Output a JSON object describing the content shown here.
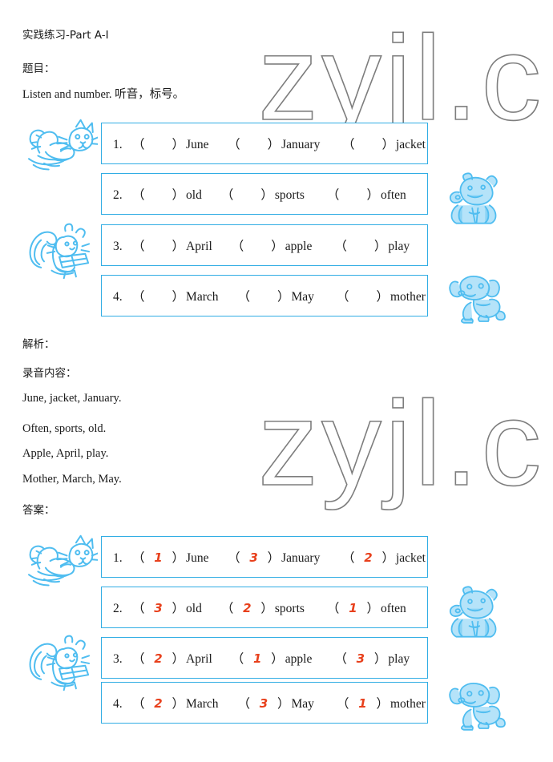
{
  "document": {
    "title": "实践练习-Part A-I",
    "section_question_label": "题目：",
    "instruction": "Listen and number. 听音，标号。",
    "section_analysis_label": "解析：",
    "section_recording_label": "录音内容：",
    "recording_lines": [
      "June, jacket, January.",
      "Often, sports, old.",
      "Apple, April, play.",
      "Mother, March, May."
    ],
    "section_answer_label": "答案："
  },
  "watermark": {
    "text": "zyjl.c"
  },
  "colors": {
    "box_border": "#31ade4",
    "answer_red": "#e8401c",
    "clipart_blue": "#4fbdf0",
    "watermark_gray": "#7d7d7d",
    "text": "#1a1a1a"
  },
  "questions": [
    {
      "number": "1.",
      "slots": [
        {
          "answer": "",
          "word": "June"
        },
        {
          "answer": "",
          "word": "January"
        },
        {
          "answer": "",
          "word": "jacket"
        }
      ]
    },
    {
      "number": "2.",
      "slots": [
        {
          "answer": "",
          "word": "old"
        },
        {
          "answer": "",
          "word": "sports"
        },
        {
          "answer": "",
          "word": "often"
        }
      ]
    },
    {
      "number": "3.",
      "slots": [
        {
          "answer": "",
          "word": "April"
        },
        {
          "answer": "",
          "word": "apple"
        },
        {
          "answer": "",
          "word": "play"
        }
      ]
    },
    {
      "number": "4.",
      "slots": [
        {
          "answer": "",
          "word": "March"
        },
        {
          "answer": "",
          "word": "May"
        },
        {
          "answer": "",
          "word": "mother"
        }
      ]
    }
  ],
  "answers": [
    {
      "number": "1.",
      "slots": [
        {
          "answer": "1",
          "word": "June"
        },
        {
          "answer": "3",
          "word": "January"
        },
        {
          "answer": "2",
          "word": "jacket"
        }
      ]
    },
    {
      "number": "2.",
      "slots": [
        {
          "answer": "3",
          "word": "old"
        },
        {
          "answer": "2",
          "word": "sports"
        },
        {
          "answer": "1",
          "word": "often"
        }
      ]
    },
    {
      "number": "3.",
      "slots": [
        {
          "answer": "2",
          "word": "April"
        },
        {
          "answer": "1",
          "word": "apple"
        },
        {
          "answer": "3",
          "word": "play"
        }
      ]
    },
    {
      "number": "4.",
      "slots": [
        {
          "answer": "2",
          "word": "March"
        },
        {
          "answer": "3",
          "word": "May"
        },
        {
          "answer": "1",
          "word": "mother"
        }
      ]
    }
  ],
  "clipart": [
    {
      "name": "cat",
      "section": "question",
      "side": "left"
    },
    {
      "name": "hippo",
      "section": "question",
      "side": "right"
    },
    {
      "name": "squirrel",
      "section": "question",
      "side": "left"
    },
    {
      "name": "dog",
      "section": "question",
      "side": "right"
    },
    {
      "name": "cat",
      "section": "answer",
      "side": "left"
    },
    {
      "name": "hippo",
      "section": "answer",
      "side": "right"
    },
    {
      "name": "squirrel",
      "section": "answer",
      "side": "left"
    },
    {
      "name": "dog",
      "section": "answer",
      "side": "right"
    }
  ]
}
